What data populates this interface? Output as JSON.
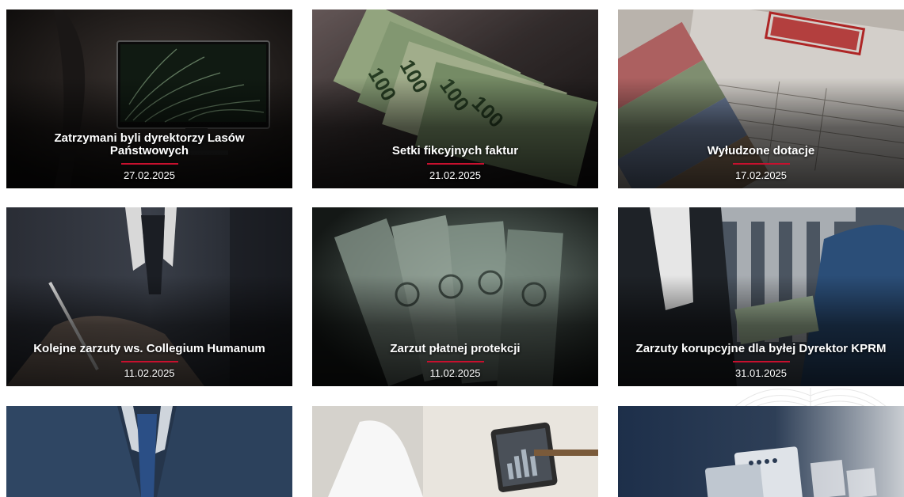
{
  "articles": [
    {
      "title": "Zatrzymani byli dyrektorzy Lasów Państwowych",
      "date": "27.02.2025",
      "image": "monitor-palm-leaves-image"
    },
    {
      "title": "Setki fikcyjnych faktur",
      "date": "21.02.2025",
      "image": "banknotes-100-pln-image"
    },
    {
      "title": "Wyłudzone dotacje",
      "date": "17.02.2025",
      "image": "invoice-oszustwo-stamp-image"
    },
    {
      "title": "Kolejne zarzuty ws. Collegium Humanum",
      "date": "11.02.2025",
      "image": "man-in-suit-signing-image"
    },
    {
      "title": "Zarzut płatnej protekcji",
      "date": "11.02.2025",
      "image": "money-stack-image"
    },
    {
      "title": "Zarzuty korupcyjne dla byłej Dyrektor KPRM",
      "date": "31.01.2025",
      "image": "suit-money-handover-image"
    },
    {
      "title": "",
      "date": "",
      "image": "businessman-suit-image"
    },
    {
      "title": "",
      "date": "",
      "image": "tablet-charts-image"
    },
    {
      "title": "",
      "date": "",
      "image": "documents-icons-image"
    }
  ],
  "colors": {
    "accent": "#c8102e",
    "caption_text": "#ffffff",
    "page_bg": "#ffffff"
  },
  "watermark": {
    "icon": "eagle-emblem-watermark"
  }
}
